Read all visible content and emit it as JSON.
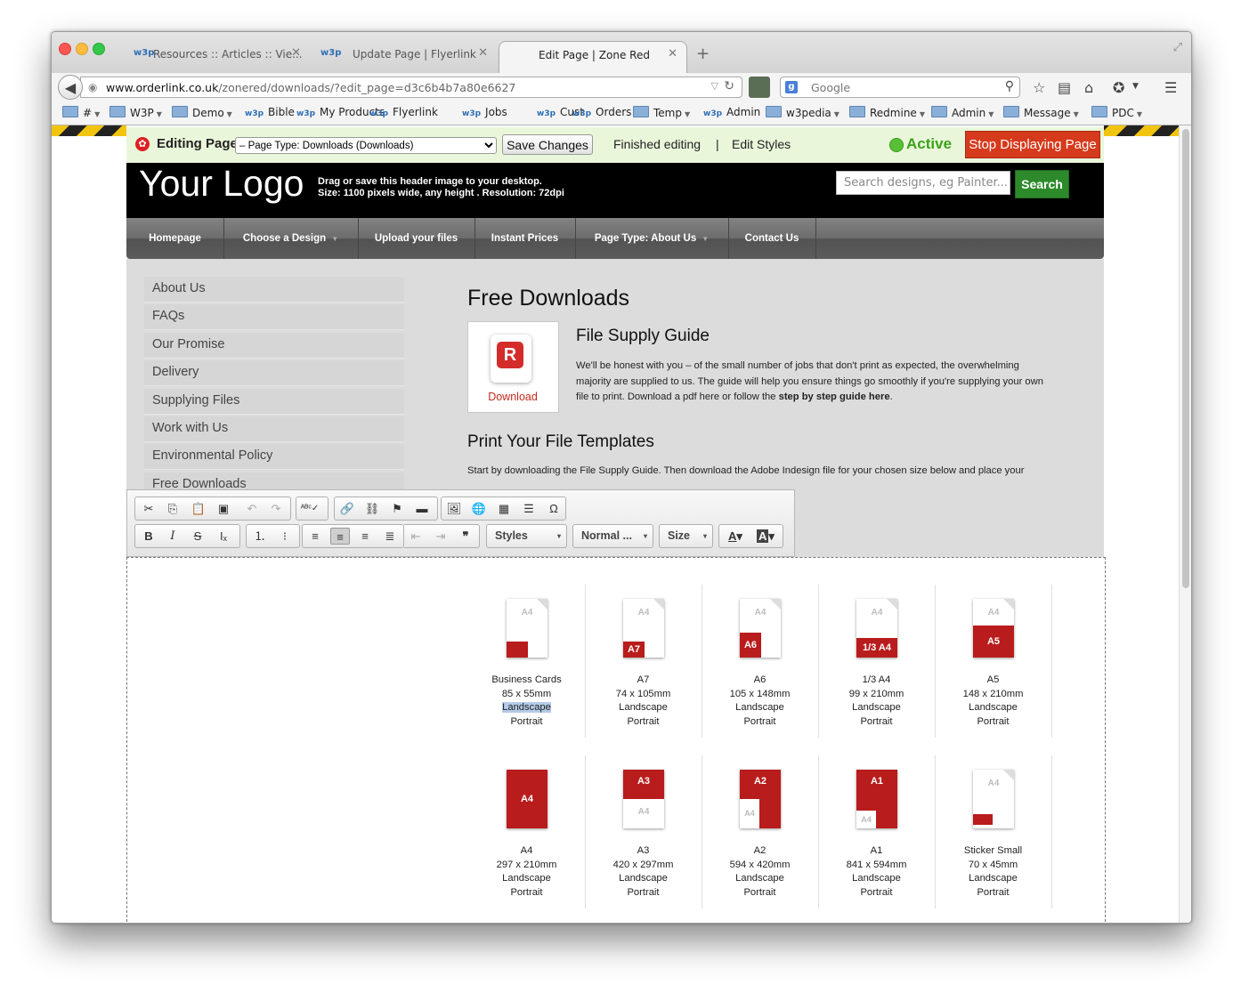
{
  "browser": {
    "tabs": [
      {
        "favicon": "w3p",
        "title": "Resources :: Articles :: Vie...",
        "active": false
      },
      {
        "favicon": "w3p",
        "title": "Update Page | Flyerlink",
        "active": false
      },
      {
        "favicon": "",
        "title": "Edit Page | Zone Red",
        "active": true
      }
    ],
    "new_tab": "+",
    "url_host": "www.orderlink.co.uk",
    "url_path": "/zonered/downloads/?edit_page=d3c6b4b7a80e6627",
    "search_placeholder": "Google",
    "bookmarks": [
      {
        "label": "#",
        "type": "folder",
        "menu": true
      },
      {
        "label": "W3P",
        "type": "folder",
        "menu": true
      },
      {
        "label": "Demo",
        "type": "folder",
        "menu": true
      },
      {
        "label": "Bible",
        "type": "w3p",
        "menu": false
      },
      {
        "label": "My Products",
        "type": "w3p",
        "menu": false
      },
      {
        "label": "Flyerlink",
        "type": "w3p",
        "menu": false
      },
      {
        "label": "Jobs",
        "type": "w3p",
        "menu": false
      },
      {
        "label": "Cust",
        "type": "w3p",
        "menu": false
      },
      {
        "label": "Orders",
        "type": "w3p",
        "menu": false
      },
      {
        "label": "Temp",
        "type": "folder",
        "menu": true
      },
      {
        "label": "Admin",
        "type": "w3p",
        "menu": false
      },
      {
        "label": "w3pedia",
        "type": "folder",
        "menu": true
      },
      {
        "label": "Redmine",
        "type": "folder",
        "menu": true
      },
      {
        "label": "Admin",
        "type": "folder",
        "menu": true
      },
      {
        "label": "Message",
        "type": "folder",
        "menu": true
      },
      {
        "label": "PDC",
        "type": "folder",
        "menu": true
      }
    ]
  },
  "editbar": {
    "label": "Editing Page:",
    "page_select": "– Page Type: Downloads (Downloads)",
    "save_label": "Save Changes",
    "finished_label": "Finished editing",
    "separator": "|",
    "edit_styles_label": "Edit Styles",
    "status": "Active",
    "stop_label": "Stop Displaying Page"
  },
  "header": {
    "logo": "Your Logo",
    "hint_line1": "Drag or save this header image to your desktop.",
    "hint_line2": "Size: 1100 pixels wide, any height . Resolution: 72dpi",
    "search_placeholder": "Search designs, eg Painter...",
    "search_button": "Search"
  },
  "menu": [
    {
      "label": "Homepage",
      "dropdown": false
    },
    {
      "label": "Choose a Design",
      "dropdown": true
    },
    {
      "label": "Upload your files",
      "dropdown": false
    },
    {
      "label": "Instant Prices",
      "dropdown": false
    },
    {
      "label": "Page Type: About Us",
      "dropdown": true
    },
    {
      "label": "Contact Us",
      "dropdown": false
    }
  ],
  "sidebar": [
    "About Us",
    "FAQs",
    "Our Promise",
    "Delivery",
    "Supplying Files",
    "Work with Us",
    "Environmental Policy",
    "Free Downloads"
  ],
  "main": {
    "title": "Free Downloads",
    "download_label": "Download",
    "guide_title": "File Supply Guide",
    "guide_text": "We'll be honest with you – of the small number of jobs that don't print as expected, the overwhelming majority are supplied to us. The guide will help you ensure things go smoothly if you're supplying your own file to print. Download a pdf here or follow the",
    "guide_link": "step by step guide here",
    "guide_end": ".",
    "templates_title": "Print Your File Templates",
    "templates_text": "Start by downloading the File Supply Guide. Then download the Adobe Indesign file for your chosen size below and place your design onto the canvas."
  },
  "editor": {
    "styles_label": "Styles",
    "format_label": "Normal ...",
    "size_label": "Size",
    "text_color_label": "A",
    "bg_color_label": "A"
  },
  "templates": [
    {
      "name": "Business Cards",
      "size": "85 x 55mm",
      "land": "Landscape",
      "port": "Portrait",
      "badge": "",
      "wm": "A4",
      "highlight": true
    },
    {
      "name": "A7",
      "size": "74 x 105mm",
      "land": "Landscape",
      "port": "Portrait",
      "badge": "A7",
      "wm": "A4",
      "highlight": false
    },
    {
      "name": "A6",
      "size": "105 x 148mm",
      "land": "Landscape",
      "port": "Portrait",
      "badge": "A6",
      "wm": "A4",
      "highlight": false
    },
    {
      "name": "1/3 A4",
      "size": "99 x 210mm",
      "land": "Landscape",
      "port": "Portrait",
      "badge": "1/3 A4",
      "wm": "A4",
      "highlight": false
    },
    {
      "name": "A5",
      "size": "148 x 210mm",
      "land": "Landscape",
      "port": "Portrait",
      "badge": "A5",
      "wm": "A4",
      "highlight": false
    },
    {
      "name": "A4",
      "size": "297 x 210mm",
      "land": "Landscape",
      "port": "Portrait",
      "badge": "A4",
      "wm": "",
      "highlight": false
    },
    {
      "name": "A3",
      "size": "420 x 297mm",
      "land": "Landscape",
      "port": "Portrait",
      "badge": "A3",
      "wm": "A4",
      "highlight": false
    },
    {
      "name": "A2",
      "size": "594 x 420mm",
      "land": "Landscape",
      "port": "Portrait",
      "badge": "A2",
      "wm": "A4",
      "highlight": false
    },
    {
      "name": "A1",
      "size": "841 x 594mm",
      "land": "Landscape",
      "port": "Portrait",
      "badge": "A1",
      "wm": "A4",
      "highlight": false
    },
    {
      "name": "Sticker Small",
      "size": "70 x 45mm",
      "land": "Landscape",
      "port": "Portrait",
      "badge": "",
      "wm": "A4",
      "highlight": false
    }
  ],
  "colors": {
    "brand_red": "#b91c1c",
    "active_green": "#3aa21a",
    "stop_red": "#d63a1c",
    "search_green": "#2d8a2a"
  }
}
